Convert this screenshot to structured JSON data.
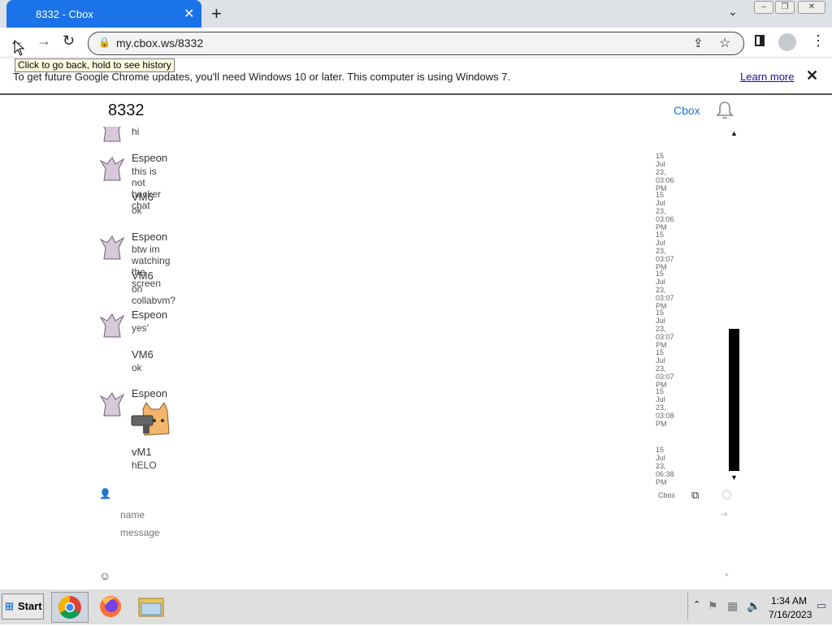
{
  "browser": {
    "tab_title": "8332 - Cbox",
    "tab_close": "✕",
    "new_tab": "+",
    "chevron": "⌄",
    "url": "my.cbox.ws/8332",
    "back_tooltip": "Click to go back, hold to see history"
  },
  "window_controls": [
    "–",
    "❐",
    "✕"
  ],
  "infobar": {
    "message": "To get future Google Chrome updates, you'll need Windows 10 or later. This computer is using Windows 7.",
    "learn_more": "Learn more",
    "close": "✕"
  },
  "chat": {
    "room": "8332",
    "header_link": "Cbox",
    "messages": [
      {
        "author": "",
        "text": "hi",
        "time": "",
        "avatar": true
      },
      {
        "author": "Espeon",
        "text": "this is not hacker chat",
        "time": "15 Jul 23, 03:06 PM",
        "avatar": true
      },
      {
        "author": "VM6",
        "text": "ok",
        "time": "15 Jul 23, 03:06 PM",
        "avatar": false
      },
      {
        "author": "Espeon",
        "text": "btw im watching the screen",
        "time": "15 Jul 23, 03:07 PM",
        "avatar": true
      },
      {
        "author": "VM6",
        "text": "on collabvm?",
        "time": "15 Jul 23, 03:07 PM",
        "avatar": false
      },
      {
        "author": "Espeon",
        "text": "yes'",
        "time": "15 Jul 23, 03:07 PM",
        "avatar": true
      },
      {
        "author": "VM6",
        "text": "ok",
        "time": "15 Jul 23, 03:07 PM",
        "avatar": false
      },
      {
        "author": "Espeon",
        "text": "",
        "time": "15 Jul 23, 03:08 PM",
        "avatar": true,
        "image": "cat-with-gun-emoji"
      },
      {
        "author": "vM1",
        "text": "hELO",
        "time": "15 Jul 23, 06:38 PM",
        "avatar": false
      }
    ],
    "footer_brand": "Cbox",
    "name_placeholder": "name",
    "message_placeholder": "message"
  },
  "taskbar": {
    "start_label": "Start",
    "apps": [
      "chrome-icon",
      "firefox-icon",
      "explorer-icon"
    ],
    "clock_time": "1:34 AM",
    "clock_date": "7/16/2023"
  }
}
